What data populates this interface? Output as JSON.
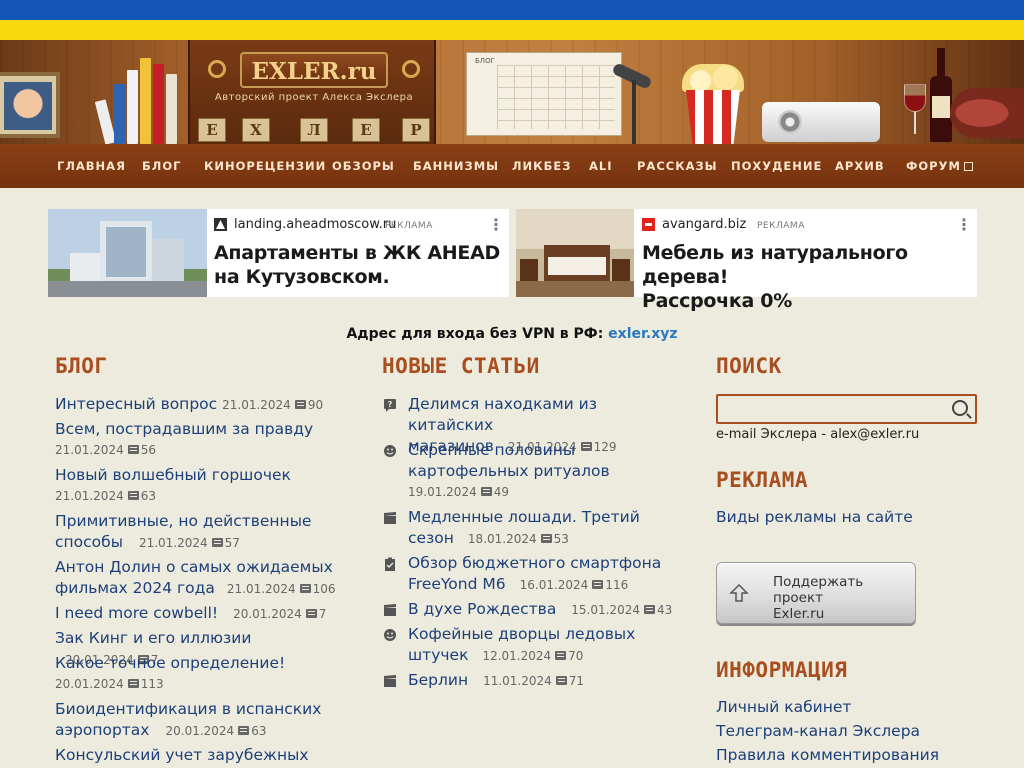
{
  "banner": {
    "logo": "EXLER.ru",
    "subtitle": "Авторский проект Алекса Экслера",
    "calendar_head": "БЛОГ",
    "tiles": [
      "Е",
      "Х",
      "Л",
      "Е",
      "Р"
    ]
  },
  "nav": {
    "items": [
      "ГЛАВНАЯ",
      "БЛОГ",
      "КИНОРЕЦЕНЗИИ",
      "ОБЗОРЫ",
      "БАННИЗМЫ",
      "ЛИКБЕЗ",
      "ALI",
      "РАССКАЗЫ",
      "ПОХУДЕНИЕ",
      "АРХИВ",
      "ФОРУМ"
    ]
  },
  "ads": [
    {
      "domain": "landing.aheadmoscow.ru",
      "tag": "РЕКЛАМА",
      "title_line1": "Апартаменты в ЖК AHEAD",
      "title_line2": "на Кутузовском."
    },
    {
      "domain": "avangard.biz",
      "tag": "РЕКЛАМА",
      "title_line1": "Мебель из натурального дерева!",
      "title_line2": "Рассрочка 0%"
    }
  ],
  "vpn": {
    "text": "Адрес для входа без VPN в РФ: ",
    "link": "exler.xyz"
  },
  "blog": {
    "title": "БЛОГ",
    "entries": [
      {
        "title": "Интересный вопрос",
        "date": "21.01.2024",
        "comments": "90"
      },
      {
        "title": "Всем, пострадавшим за правду",
        "date": "21.01.2024",
        "comments": "56"
      },
      {
        "title": "Новый волшебный горшочек",
        "date": "21.01.2024",
        "comments": "63"
      },
      {
        "title_line1": "Примитивные, но действенные",
        "title_line2": "способы",
        "date": "21.01.2024",
        "comments": "57"
      },
      {
        "title_line1": "Антон Долин о самых ожидаемых",
        "title_line2": "фильмах 2024 года",
        "date": "21.01.2024",
        "comments": "106"
      },
      {
        "title": "I need more cowbell!",
        "date": "20.01.2024",
        "comments": "7"
      },
      {
        "title": "Зак Кинг и его иллюзии",
        "date": "20.01.2024",
        "comments": "7"
      },
      {
        "title": "Какое точное определение!",
        "date": "20.01.2024",
        "comments": "113"
      },
      {
        "title_line1": "Биоидентификация в испанских",
        "title_line2": "аэропортах",
        "date": "20.01.2024",
        "comments": "63"
      },
      {
        "title": "Консульский учет зарубежных"
      }
    ]
  },
  "articles": {
    "title": "НОВЫЕ СТАТЬИ",
    "entries": [
      {
        "icon": "question-icon",
        "title_line1": "Делимся находками из китайских",
        "title_line2": "магазинов",
        "date": "21.01.2024",
        "comments": "129"
      },
      {
        "icon": "smile-icon",
        "title_line1": "Скрепные половины",
        "title_line2": "картофельных ритуалов",
        "date": "19.01.2024",
        "comments": "49"
      },
      {
        "icon": "clapper-icon",
        "title_line1": "Медленные лошади. Третий",
        "title_line2": "сезон",
        "date": "18.01.2024",
        "comments": "53"
      },
      {
        "icon": "clipboard-icon",
        "title_line1": "Обзор бюджетного смартфона",
        "title_line2": "FreeYond M6",
        "date": "16.01.2024",
        "comments": "116"
      },
      {
        "icon": "clapper-icon",
        "title": "В духе Рождества",
        "date": "15.01.2024",
        "comments": "43"
      },
      {
        "icon": "smile-icon",
        "title_line1": "Кофейные дворцы ледовых",
        "title_line2": "штучек",
        "date": "12.01.2024",
        "comments": "70"
      },
      {
        "icon": "clapper-icon",
        "title": "Берлин",
        "date": "11.01.2024",
        "comments": "71"
      }
    ]
  },
  "search": {
    "title": "ПОИСК",
    "value": "",
    "email": "e-mail Экслера - alex@exler.ru"
  },
  "ad_section": {
    "title": "РЕКЛАМА",
    "link": "Виды рекламы на сайте"
  },
  "support": {
    "line1": "Поддержать проект",
    "line2": "Exler.ru"
  },
  "info": {
    "title": "ИНФОРМАЦИЯ",
    "links": [
      "Личный кабинет",
      "Телеграм-канал Экслера",
      "Правила комментирования"
    ]
  },
  "colors": {
    "accent": "#a84e1f",
    "link": "#1d3f7a",
    "nav_bg": "#7e3712",
    "page_bg": "#ecebdd"
  }
}
